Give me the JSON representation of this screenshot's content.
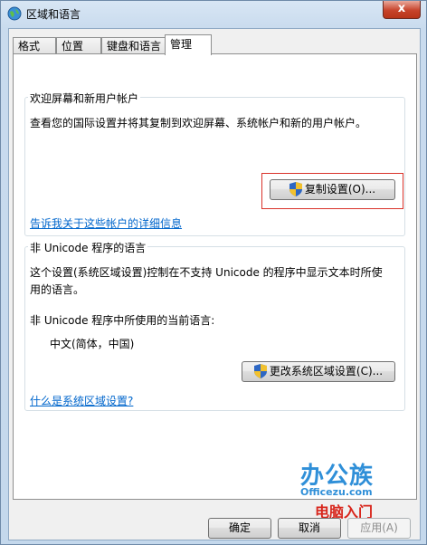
{
  "window": {
    "title": "区域和语言",
    "close_label": "x"
  },
  "tabs": [
    {
      "label": "格式"
    },
    {
      "label": "位置"
    },
    {
      "label": "键盘和语言"
    },
    {
      "label": "管理"
    }
  ],
  "welcome_group": {
    "title": "欢迎屏幕和新用户帐户",
    "description": "查看您的国际设置并将其复制到欢迎屏幕、系统帐户和新的用户帐户。",
    "copy_button": "复制设置(O)...",
    "link": "告诉我关于这些帐户的详细信息"
  },
  "unicode_group": {
    "title": "非 Unicode 程序的语言",
    "description_line1": "这个设置(系统区域设置)控制在不支持 Unicode 的程序中显示文本时所使",
    "description_line2": "用的语言。",
    "current_label": "非 Unicode 程序中所使用的当前语言:",
    "current_value": "中文(简体，中国)",
    "change_button": "更改系统区域设置(C)...",
    "link": "什么是系统区域设置?"
  },
  "footer": {
    "ok": "确定",
    "cancel": "取消",
    "apply": "应用(A)"
  },
  "watermark": {
    "line1": "办公族",
    "line2": "Officezu.com",
    "line3": "电脑入门"
  },
  "colors": {
    "link": "#0066cc",
    "highlight_box": "#d9322a",
    "watermark_blue": "#2f8fd8",
    "watermark_red": "#d8261c"
  }
}
